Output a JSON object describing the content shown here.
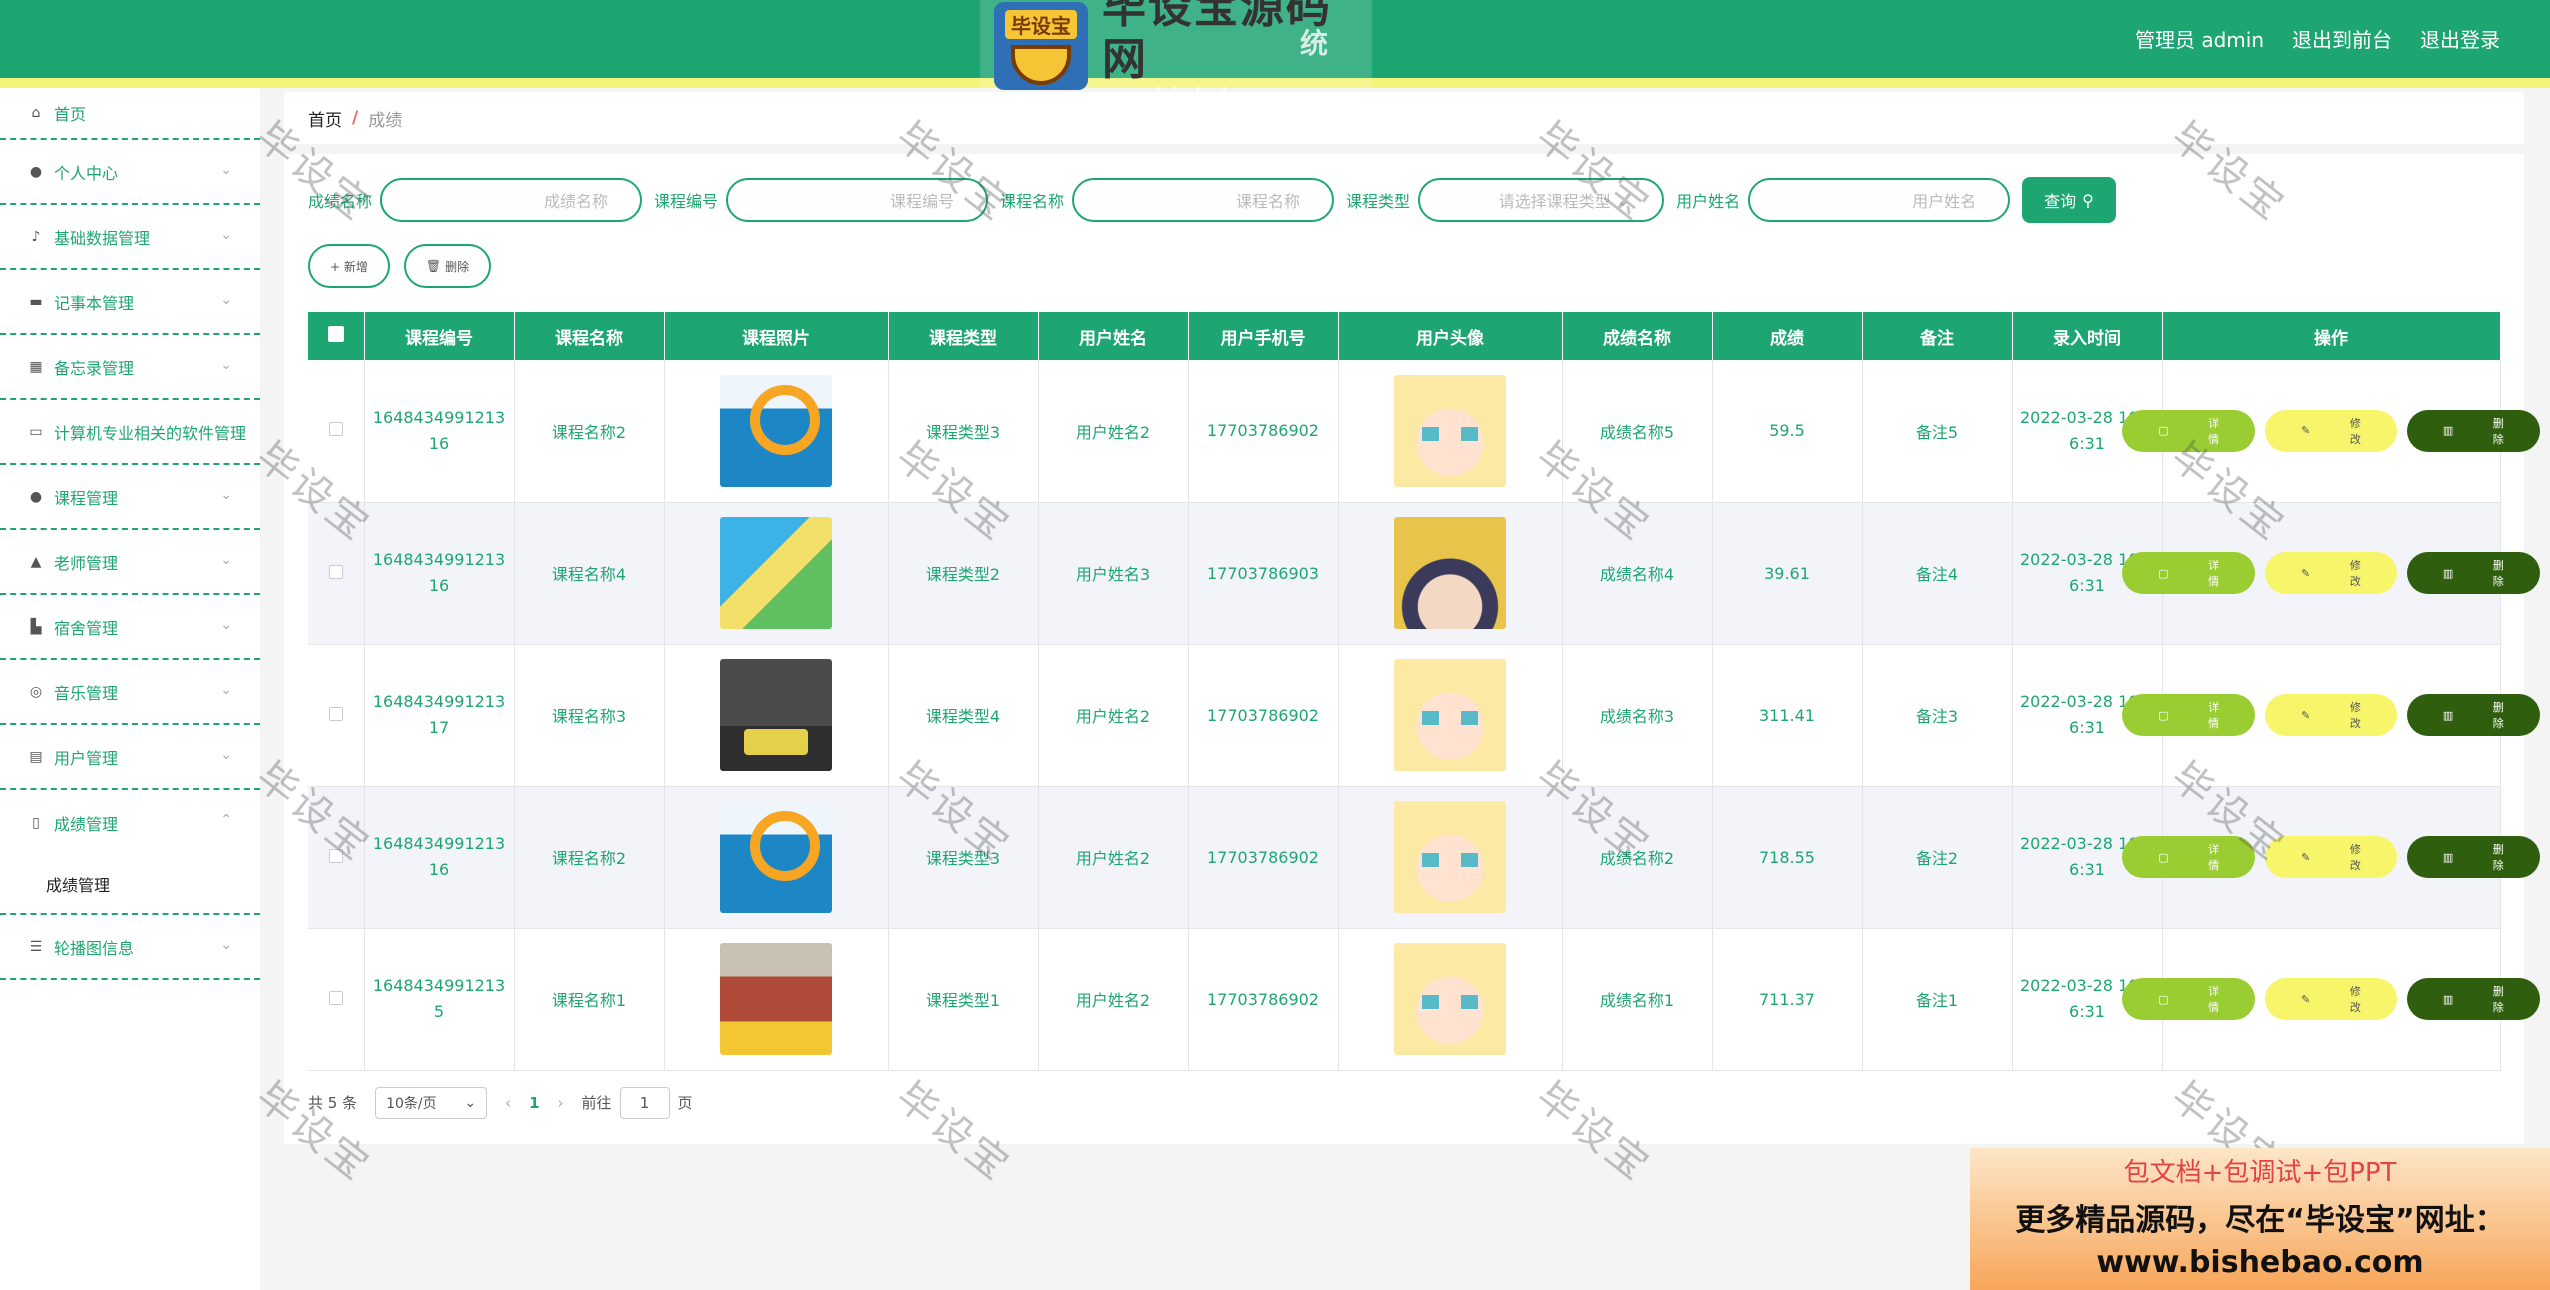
{
  "header": {
    "logo_badge": "毕设宝",
    "logo_title": "毕设宝源码网",
    "logo_url": "www.bishebao.com",
    "title_behind": "统",
    "user_label": "管理员 admin",
    "to_front": "退出到前台",
    "logout": "退出登录"
  },
  "sidebar": {
    "items": [
      {
        "label": "首页",
        "icon": "home-icon"
      },
      {
        "label": "个人中心",
        "icon": "user-icon"
      },
      {
        "label": "基础数据管理",
        "icon": "bell-off-icon"
      },
      {
        "label": "记事本管理",
        "icon": "monitor-icon"
      },
      {
        "label": "备忘录管理",
        "icon": "chart-icon"
      },
      {
        "label": "计算机专业相关的软件管理",
        "icon": "chat-icon"
      },
      {
        "label": "课程管理",
        "icon": "user-icon"
      },
      {
        "label": "老师管理",
        "icon": "user-up-icon"
      },
      {
        "label": "宿舍管理",
        "icon": "thumb-icon"
      },
      {
        "label": "音乐管理",
        "icon": "compass-icon"
      },
      {
        "label": "用户管理",
        "icon": "clipboard-icon"
      },
      {
        "label": "成绩管理",
        "icon": "mic-icon"
      },
      {
        "label": "轮播图信息",
        "icon": "sliders-icon"
      }
    ],
    "submenu_label": "成绩管理"
  },
  "breadcrumb": {
    "home": "首页",
    "sep": "/",
    "current": "成绩"
  },
  "search": {
    "fields": [
      {
        "label": "成绩名称",
        "placeholder": "成绩名称"
      },
      {
        "label": "课程编号",
        "placeholder": "课程编号"
      },
      {
        "label": "课程名称",
        "placeholder": "课程名称"
      },
      {
        "label": "课程类型",
        "placeholder": "请选择课程类型"
      },
      {
        "label": "用户姓名",
        "placeholder": "用户姓名"
      }
    ],
    "query_button": "查询"
  },
  "actions": {
    "add": "+ 新增",
    "delete": "删除"
  },
  "table": {
    "headers": [
      "课程编号",
      "课程名称",
      "课程照片",
      "课程类型",
      "用户姓名",
      "用户手机号",
      "用户头像",
      "成绩名称",
      "成绩",
      "备注",
      "录入时间",
      "操作"
    ],
    "rows": [
      {
        "code": "164843499121316",
        "name": "课程名称2",
        "type": "课程类型3",
        "user": "用户姓名2",
        "phone": "17703786902",
        "score_name": "成绩名称5",
        "score": "59.5",
        "note": "备注5",
        "time": "2022-03-28 10:36:31"
      },
      {
        "code": "164843499121316",
        "name": "课程名称4",
        "type": "课程类型2",
        "user": "用户姓名3",
        "phone": "17703786903",
        "score_name": "成绩名称4",
        "score": "39.61",
        "note": "备注4",
        "time": "2022-03-28 10:36:31"
      },
      {
        "code": "164843499121317",
        "name": "课程名称3",
        "type": "课程类型4",
        "user": "用户姓名2",
        "phone": "17703786902",
        "score_name": "成绩名称3",
        "score": "311.41",
        "note": "备注3",
        "time": "2022-03-28 10:36:31"
      },
      {
        "code": "164843499121316",
        "name": "课程名称2",
        "type": "课程类型3",
        "user": "用户姓名2",
        "phone": "17703786902",
        "score_name": "成绩名称2",
        "score": "718.55",
        "note": "备注2",
        "time": "2022-03-28 10:36:31"
      },
      {
        "code": "16484349912135",
        "name": "课程名称1",
        "type": "课程类型1",
        "user": "用户姓名2",
        "phone": "17703786902",
        "score_name": "成绩名称1",
        "score": "711.37",
        "note": "备注1",
        "time": "2022-03-28 10:36:31"
      }
    ],
    "op_detail": "详情",
    "op_edit": "修改",
    "op_delete": "删除"
  },
  "pagination": {
    "total": "共 5 条",
    "page_size": "10条/页",
    "current_page": "1",
    "goto_prefix": "前往",
    "goto_value": "1",
    "goto_suffix": "页"
  },
  "watermark": "毕设宝",
  "ad": {
    "line1": "包文档+包调试+包PPT",
    "line2": "更多精品源码，尽在“毕设宝”网址：",
    "line3": "www.bishebao.com"
  },
  "colors": {
    "primary": "#1ea672",
    "stripe": "#f3f57a",
    "detail": "#9acd32",
    "edit": "#f7f56a",
    "delete": "#2f5e0e"
  }
}
